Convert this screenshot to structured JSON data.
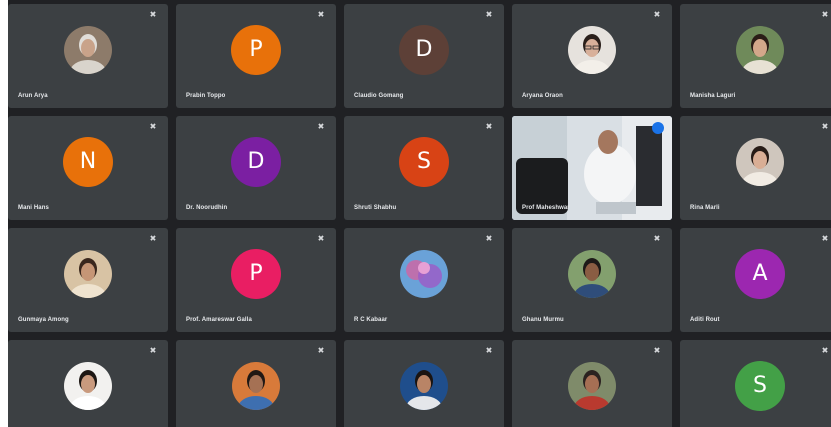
{
  "meeting_grid": {
    "rows": [
      [
        {
          "name": "Arun Arya",
          "type": "photo",
          "photo": "elderly-man-photo"
        },
        {
          "name": "Prabin Toppo",
          "type": "letter",
          "letter": "P",
          "color": "#e8710a"
        },
        {
          "name": "Claudio Gomang",
          "type": "letter",
          "letter": "D",
          "color": "#5d4037"
        },
        {
          "name": "Aryana Oraon",
          "type": "photo",
          "photo": "woman-glasses-photo"
        },
        {
          "name": "Manisha Laguri",
          "type": "photo",
          "photo": "woman-outdoor-photo"
        }
      ],
      [
        {
          "name": "Mani Hans",
          "type": "letter",
          "letter": "N",
          "color": "#e8710a"
        },
        {
          "name": "Dr. Noorudhin",
          "type": "letter",
          "letter": "D",
          "color": "#7b1fa2"
        },
        {
          "name": "Shruti Shabhu",
          "type": "letter",
          "letter": "S",
          "color": "#d84315"
        },
        {
          "name": "Prof Maheshwar",
          "type": "video",
          "photo": "seated-man-video"
        },
        {
          "name": "Rina Marli",
          "type": "photo",
          "photo": "woman-portrait-photo"
        }
      ],
      [
        {
          "name": "Gunmaya Among",
          "type": "photo",
          "photo": "woman-cream-photo"
        },
        {
          "name": "Prof. Amareswar Galla",
          "type": "letter",
          "letter": "P",
          "color": "#e91e63"
        },
        {
          "name": "R C Kabaar",
          "type": "photo",
          "photo": "pink-flowers-photo"
        },
        {
          "name": "Ghanu Murmu",
          "type": "photo",
          "photo": "man-outdoor-photo"
        },
        {
          "name": "Aditi Rout",
          "type": "letter",
          "letter": "A",
          "color": "#9c27b0"
        }
      ],
      [
        {
          "name": "",
          "type": "photo",
          "photo": "woman-white-photo"
        },
        {
          "name": "",
          "type": "photo",
          "photo": "man-colorful-photo"
        },
        {
          "name": "",
          "type": "photo",
          "photo": "young-man-blue-photo"
        },
        {
          "name": "",
          "type": "photo",
          "photo": "man-red-photo"
        },
        {
          "name": "",
          "type": "letter",
          "letter": "S",
          "color": "#43a047"
        }
      ]
    ],
    "mic_icon": "mic-off-icon",
    "pinned_border_color": "#8ab4f8",
    "tile_color": "#3c4043",
    "background_color": "#202124"
  }
}
